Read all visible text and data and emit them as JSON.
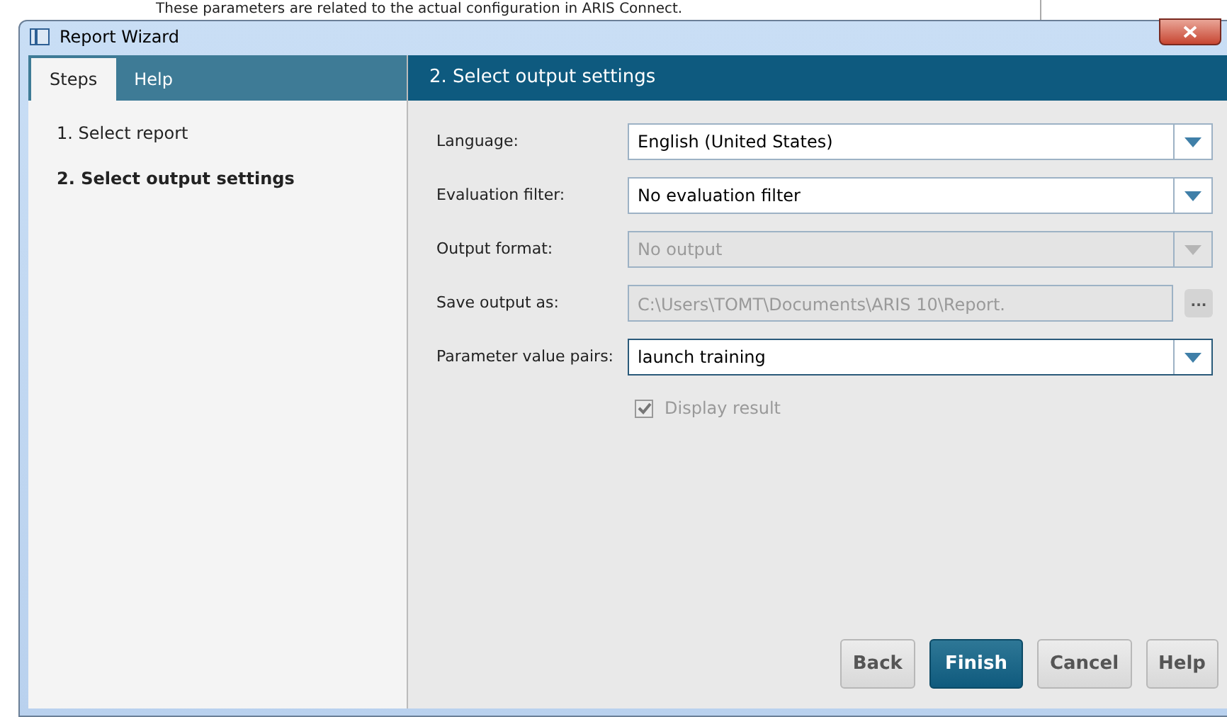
{
  "background_text": "These parameters are related to the actual configuration in ARIS Connect.",
  "window": {
    "title": "Report Wizard"
  },
  "sidebar": {
    "tabs": [
      {
        "label": "Steps",
        "selected": true
      },
      {
        "label": "Help",
        "selected": false
      }
    ],
    "steps": [
      {
        "label": "1. Select report",
        "selected": false
      },
      {
        "label": "2. Select output settings",
        "selected": true
      }
    ]
  },
  "page": {
    "title": "2. Select output settings",
    "fields": [
      {
        "kind": "combo",
        "label": "Language:",
        "value": "English (United States)",
        "disabled": false,
        "focused": false
      },
      {
        "kind": "combo",
        "label": "Evaluation filter:",
        "value": "No evaluation filter",
        "disabled": false,
        "focused": false
      },
      {
        "kind": "combo",
        "label": "Output format:",
        "value": "No output",
        "disabled": true,
        "focused": false
      },
      {
        "kind": "path",
        "label": "Save output as:",
        "value": "C:\\Users\\TOMT\\Documents\\ARIS 10\\Report.",
        "disabled": true,
        "focused": false,
        "browse": "..."
      },
      {
        "kind": "combo",
        "label": "Parameter value pairs:",
        "value": "launch training",
        "disabled": false,
        "focused": true
      }
    ],
    "display_result": {
      "label": "Display result",
      "checked": true,
      "disabled": true
    }
  },
  "buttons": [
    {
      "label": "Back",
      "primary": false
    },
    {
      "label": "Finish",
      "primary": true
    },
    {
      "label": "Cancel",
      "primary": false
    },
    {
      "label": "Help",
      "primary": false
    }
  ]
}
